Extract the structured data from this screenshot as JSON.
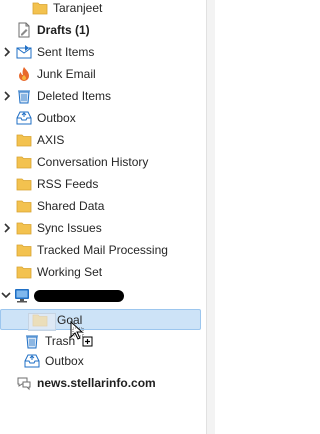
{
  "colors": {
    "folder": "#f3c24f",
    "folder_dark": "#d9a431",
    "blue_icon": "#1f6fc5",
    "selection": "#cde3f7",
    "selection_border": "#9cc6ee",
    "junk_orange": "#e8682a"
  },
  "folders": {
    "taranjeet": "Taranjeet",
    "drafts": "Drafts (1)",
    "sent_items": "Sent Items",
    "junk_email": "Junk Email",
    "deleted_items": "Deleted Items",
    "outbox": "Outbox",
    "axis": "AXIS",
    "conversation_history": "Conversation History",
    "rss_feeds": "RSS Feeds",
    "shared_data": "Shared Data",
    "sync_issues": "Sync Issues",
    "tracked_mail_processing": "Tracked Mail Processing",
    "working_set": "Working Set"
  },
  "account2": {
    "goal": "Goal",
    "trash": "Trash",
    "outbox": "Outbox"
  },
  "news_account": "news.stellarinfo.com",
  "icons": {
    "folder": "folder-icon",
    "drafts": "drafts-icon",
    "sent": "sent-items-icon",
    "junk": "junk-email-icon",
    "deleted": "deleted-items-icon",
    "outbox": "outbox-icon",
    "account": "computer-account-icon",
    "trash": "trash-icon",
    "news": "newsgroup-icon",
    "cursor": "drag-copy-cursor-icon"
  }
}
